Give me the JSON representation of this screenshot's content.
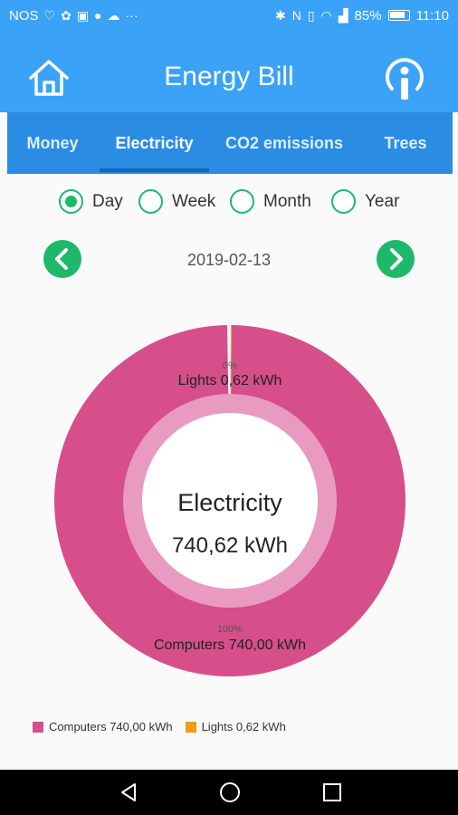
{
  "status_bar": {
    "carrier": "NOS",
    "left_icons": [
      "heart-icon",
      "paw-icon",
      "bookmark-icon",
      "circle-icon",
      "cloud-icon",
      "more-icon"
    ],
    "battery": "85%",
    "time": "11:10"
  },
  "header": {
    "title": "Energy Bill",
    "accent": "#3aa2f7"
  },
  "tabs": [
    {
      "label": "Money",
      "active": false
    },
    {
      "label": "Electricity",
      "active": true
    },
    {
      "label": "CO2 emissions",
      "active": false
    },
    {
      "label": "Trees",
      "active": false
    }
  ],
  "period_options": [
    {
      "label": "Day",
      "checked": true
    },
    {
      "label": "Week",
      "checked": false
    },
    {
      "label": "Month",
      "checked": false
    },
    {
      "label": "Year",
      "checked": false
    }
  ],
  "date": "2019-02-13",
  "chart_data": {
    "type": "pie",
    "center_title": "Electricity",
    "center_value": "740,62 kWh",
    "slices": [
      {
        "name": "Computers",
        "value": 740.0,
        "percent_label": "100%",
        "label": "Computers 740,00 kWh",
        "color": "#d64f8a"
      },
      {
        "name": "Lights",
        "value": 0.62,
        "percent_label": "0%",
        "label": "Lights 0,62 kWh",
        "color": "#f39c12"
      }
    ],
    "legend_placement": "bottom-left"
  },
  "legend": [
    {
      "label": "Computers 740,00 kWh",
      "color": "#d64f8a"
    },
    {
      "label": "Lights 0,62 kWh",
      "color": "#f39c12"
    }
  ]
}
